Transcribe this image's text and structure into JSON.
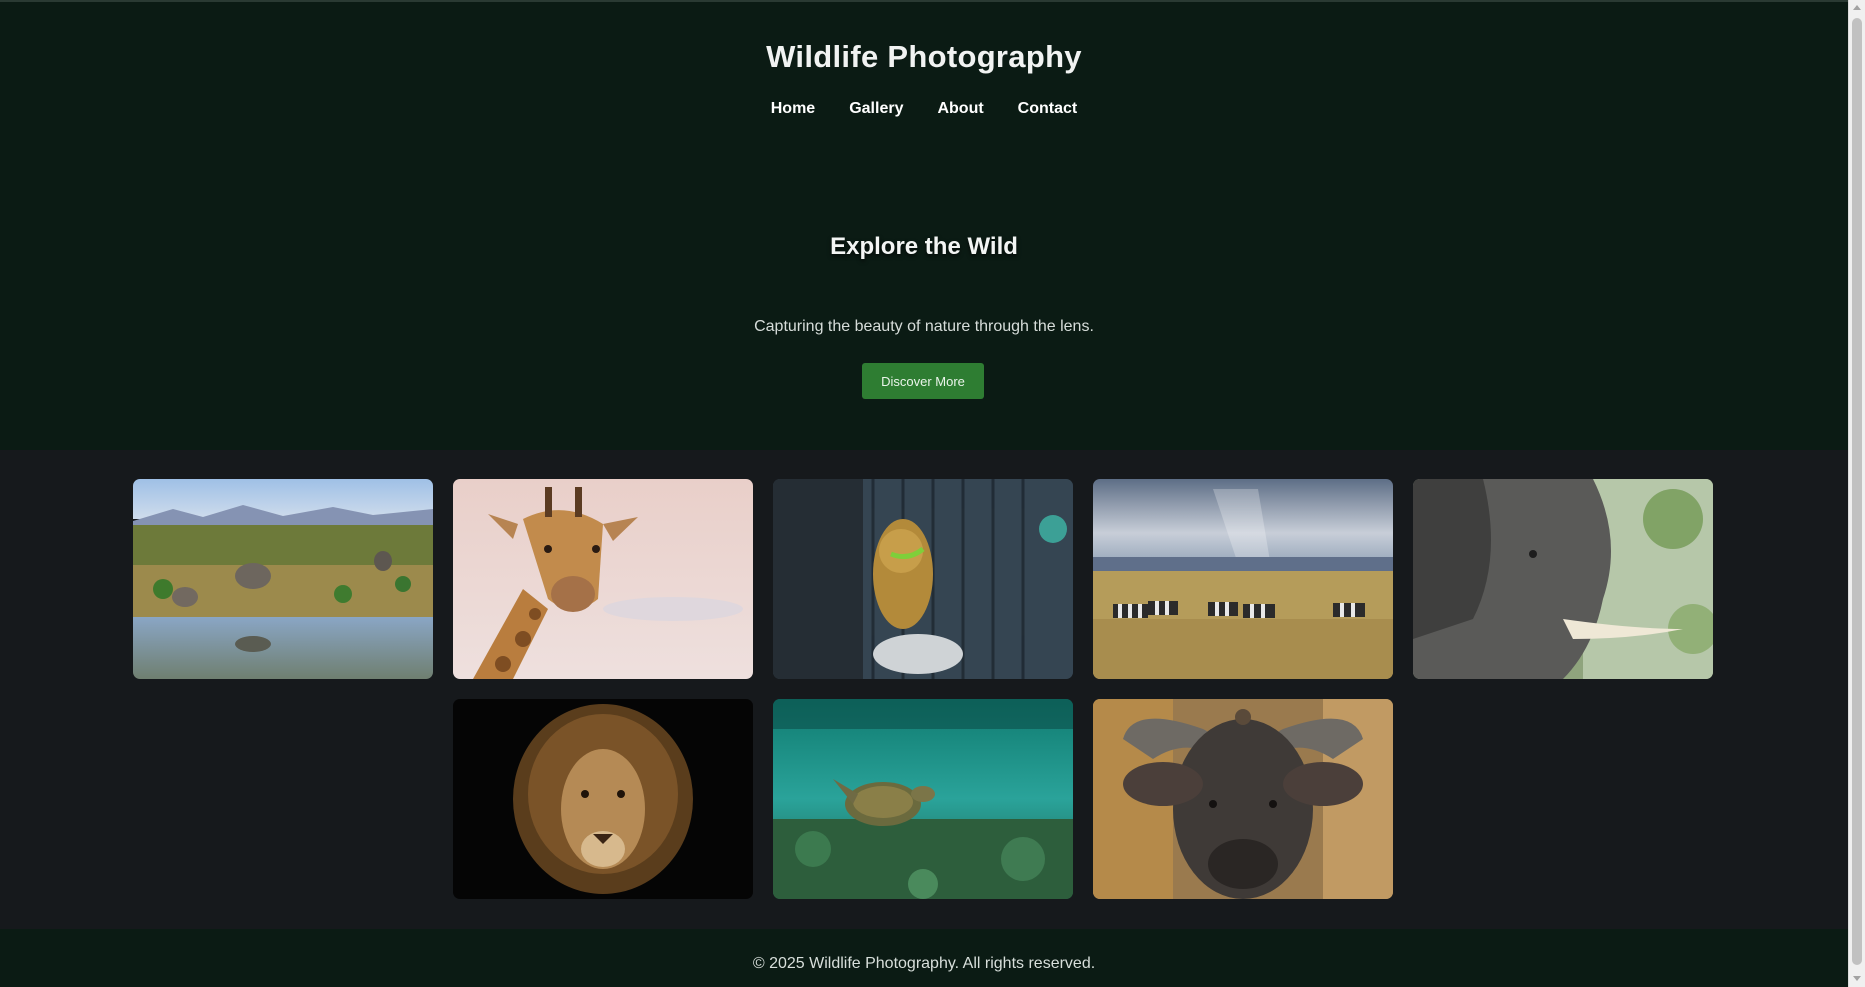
{
  "site": {
    "title": "Wildlife Photography"
  },
  "nav": {
    "items": [
      "Home",
      "Gallery",
      "About",
      "Contact"
    ]
  },
  "hero": {
    "title": "Explore the Wild",
    "subtitle": "Capturing the beauty of nature through the lens.",
    "button_label": "Discover More"
  },
  "gallery": {
    "photos": [
      "elephants-at-waterhole",
      "giraffe-portrait",
      "young-monkey",
      "zebras-on-savanna",
      "elephant-close-up",
      "lion-portrait",
      "sea-turtle-underwater",
      "cape-buffalo"
    ]
  },
  "footer": {
    "copyright": "© 2025 Wildlife Photography. All rights reserved."
  },
  "colors": {
    "header_bg": "#0b1b14",
    "page_bg": "#16191c",
    "accent": "#2e7d32"
  }
}
